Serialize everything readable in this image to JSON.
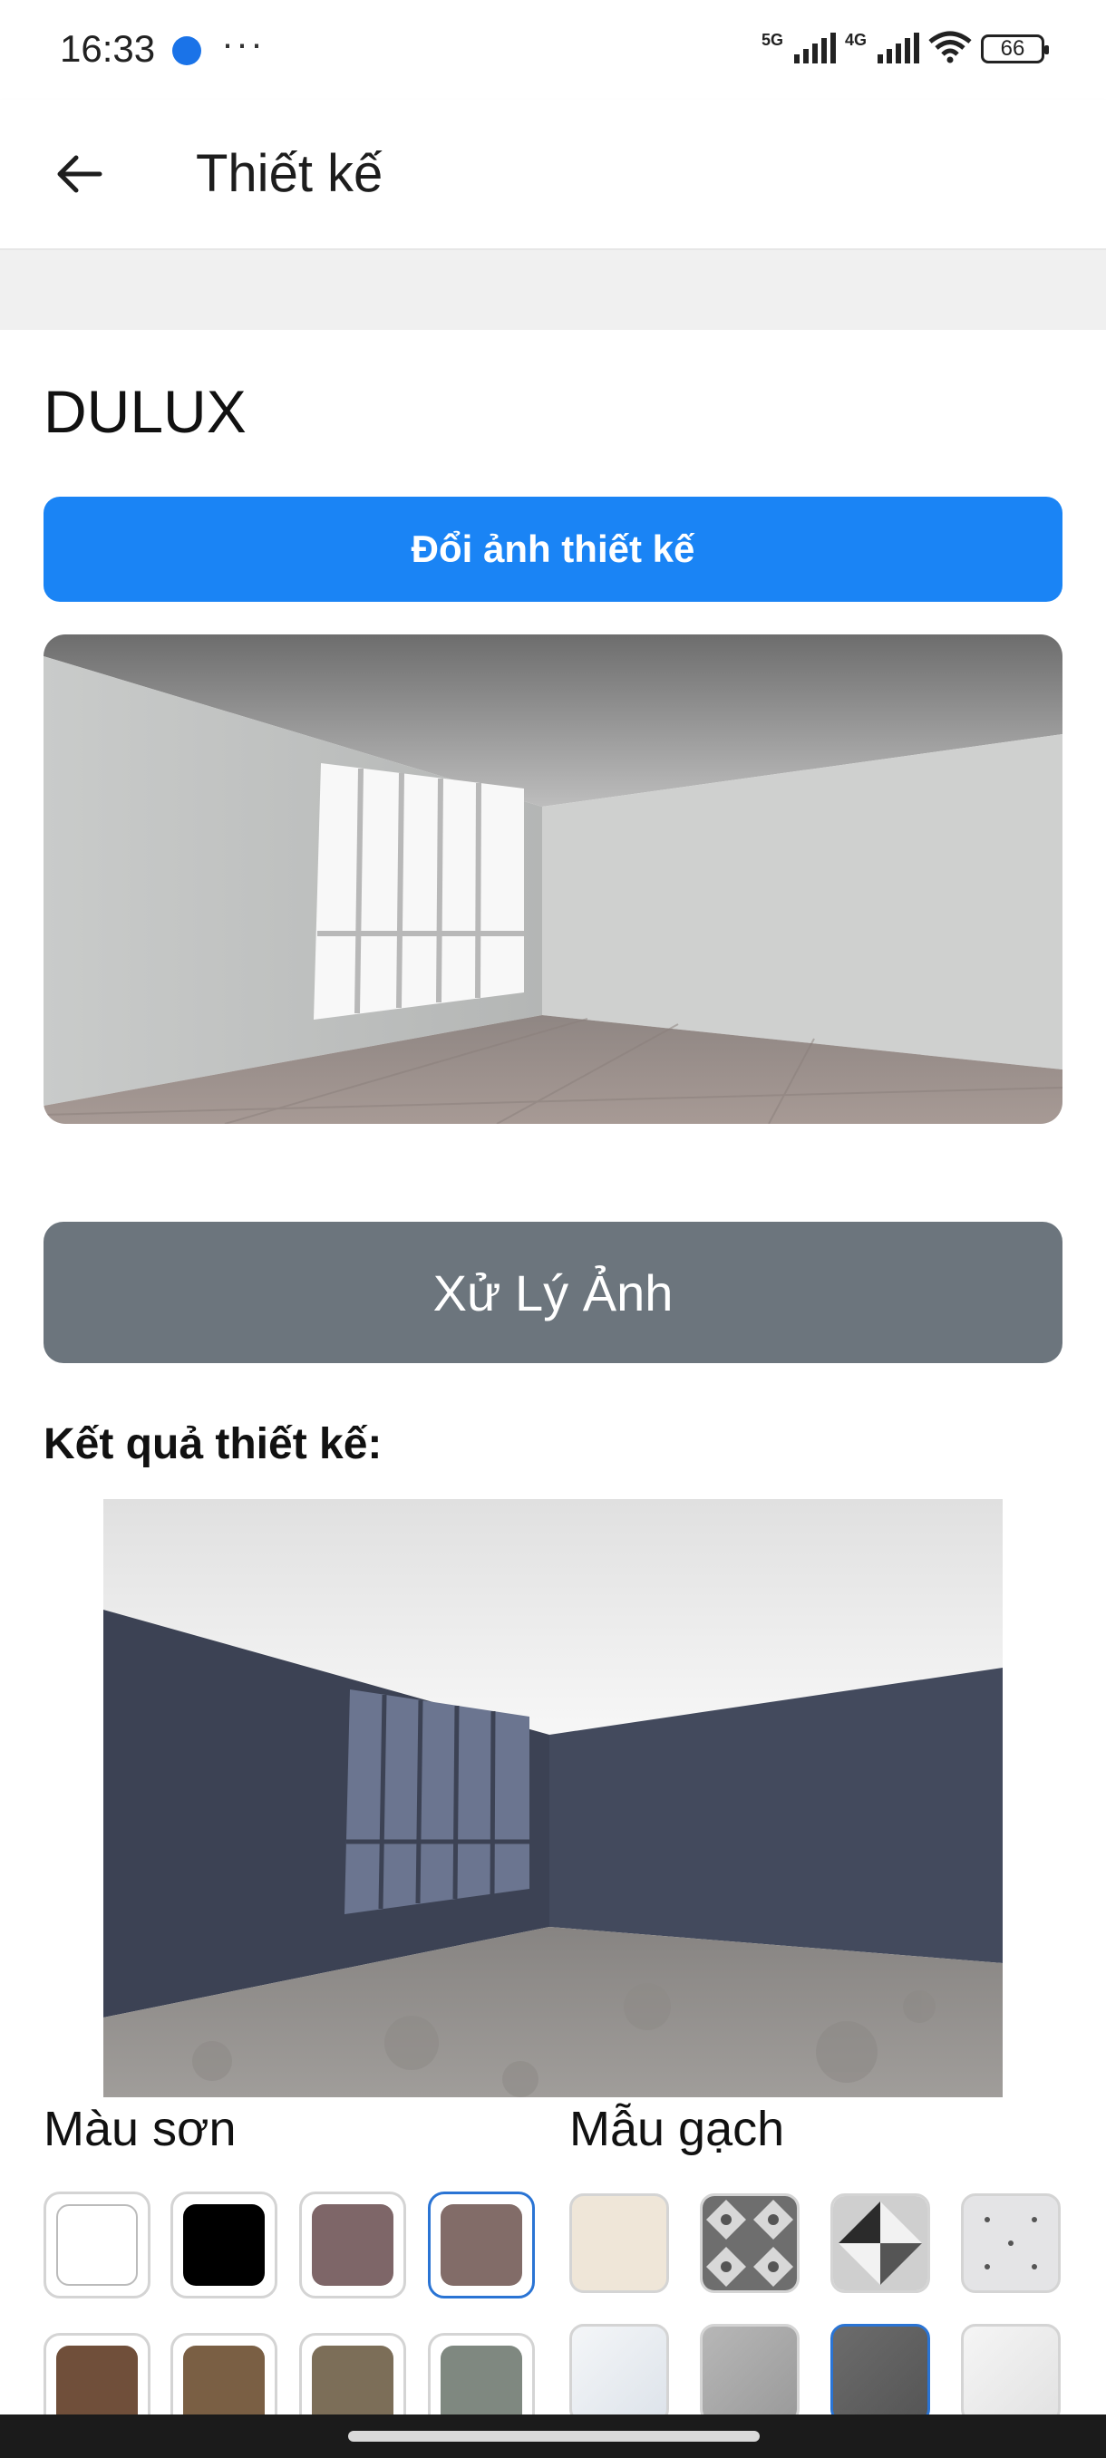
{
  "status": {
    "time": "16:33",
    "sig1": "5G",
    "sig2": "4G",
    "battery": "66"
  },
  "header": {
    "title": "Thiết kế"
  },
  "brand": "DULUX",
  "buttons": {
    "change_image": "Đổi ảnh thiết kế",
    "process": "Xử Lý Ảnh"
  },
  "result_label": "Kết quả thiết kế:",
  "sections": {
    "paint": "Màu sơn",
    "tile": "Mẫu gạch"
  },
  "paint_colors": [
    {
      "hex": "#ffffff",
      "selected": false
    },
    {
      "hex": "#000000",
      "selected": false
    },
    {
      "hex": "#7e6668",
      "selected": false
    },
    {
      "hex": "#826c68",
      "selected": true
    },
    {
      "hex": "#704f3a",
      "selected": false
    },
    {
      "hex": "#7a5f44",
      "selected": false
    },
    {
      "hex": "#7c6e58",
      "selected": false
    },
    {
      "hex": "#7f8880",
      "selected": false
    }
  ],
  "tile_patterns": [
    {
      "name": "cream-plain",
      "selected": false
    },
    {
      "name": "gray-diamond",
      "selected": false
    },
    {
      "name": "black-white-triangle",
      "selected": false
    },
    {
      "name": "light-gray-dots",
      "selected": false
    },
    {
      "name": "white-marble",
      "selected": false
    },
    {
      "name": "gray-stone",
      "selected": false
    },
    {
      "name": "dark-gray-stone",
      "selected": true
    },
    {
      "name": "white-stone",
      "selected": false
    }
  ],
  "colors": {
    "accent": "#1a84f5",
    "process_button": "#6c757d",
    "result_wall": "#3f4658"
  }
}
